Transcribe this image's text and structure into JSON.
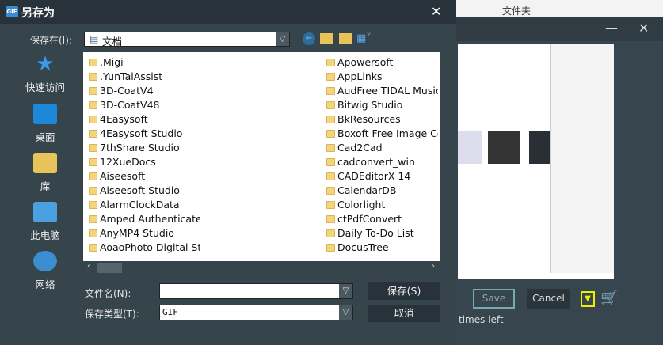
{
  "dialog": {
    "title": "另存为",
    "close": "✕"
  },
  "location": {
    "label": "保存在(I):",
    "value": "文档"
  },
  "nav": [
    {
      "label": "快速访问"
    },
    {
      "label": "桌面"
    },
    {
      "label": "库"
    },
    {
      "label": "此电脑"
    },
    {
      "label": "网络"
    }
  ],
  "files_col1": [
    ".Migi",
    ".YunTaiAssist",
    "3D-CoatV4",
    "3D-CoatV48",
    "4Easysoft",
    "4Easysoft Studio",
    "7thShare Studio",
    "12XueDocs",
    "Aiseesoft",
    "Aiseesoft Studio",
    "AlarmClockData",
    "Amped Authenticate",
    "AnyMP4 Studio",
    "AoaoPhoto Digital Studio"
  ],
  "files_col2": [
    "Apowersoft",
    "AppLinks",
    "AudFree TIDAL Music",
    "Bitwig Studio",
    "BkResources",
    "Boxoft Free Image Co",
    "Cad2Cad",
    "cadconvert_win",
    "CADEditorX 14",
    "CalendarDB",
    "Colorlight",
    "ctPdfConvert",
    "Daily To-Do List",
    "DocusTree"
  ],
  "filename": {
    "label": "文件名(N):",
    "value": ""
  },
  "filetype": {
    "label": "保存类型(T):",
    "value": "GIF"
  },
  "buttons": {
    "save": "保存(S)",
    "cancel": "取消"
  },
  "background": {
    "ribbon_new_folder": "文件夹",
    "save": "Save",
    "cancel": "Cancel",
    "times_left": "times left"
  }
}
